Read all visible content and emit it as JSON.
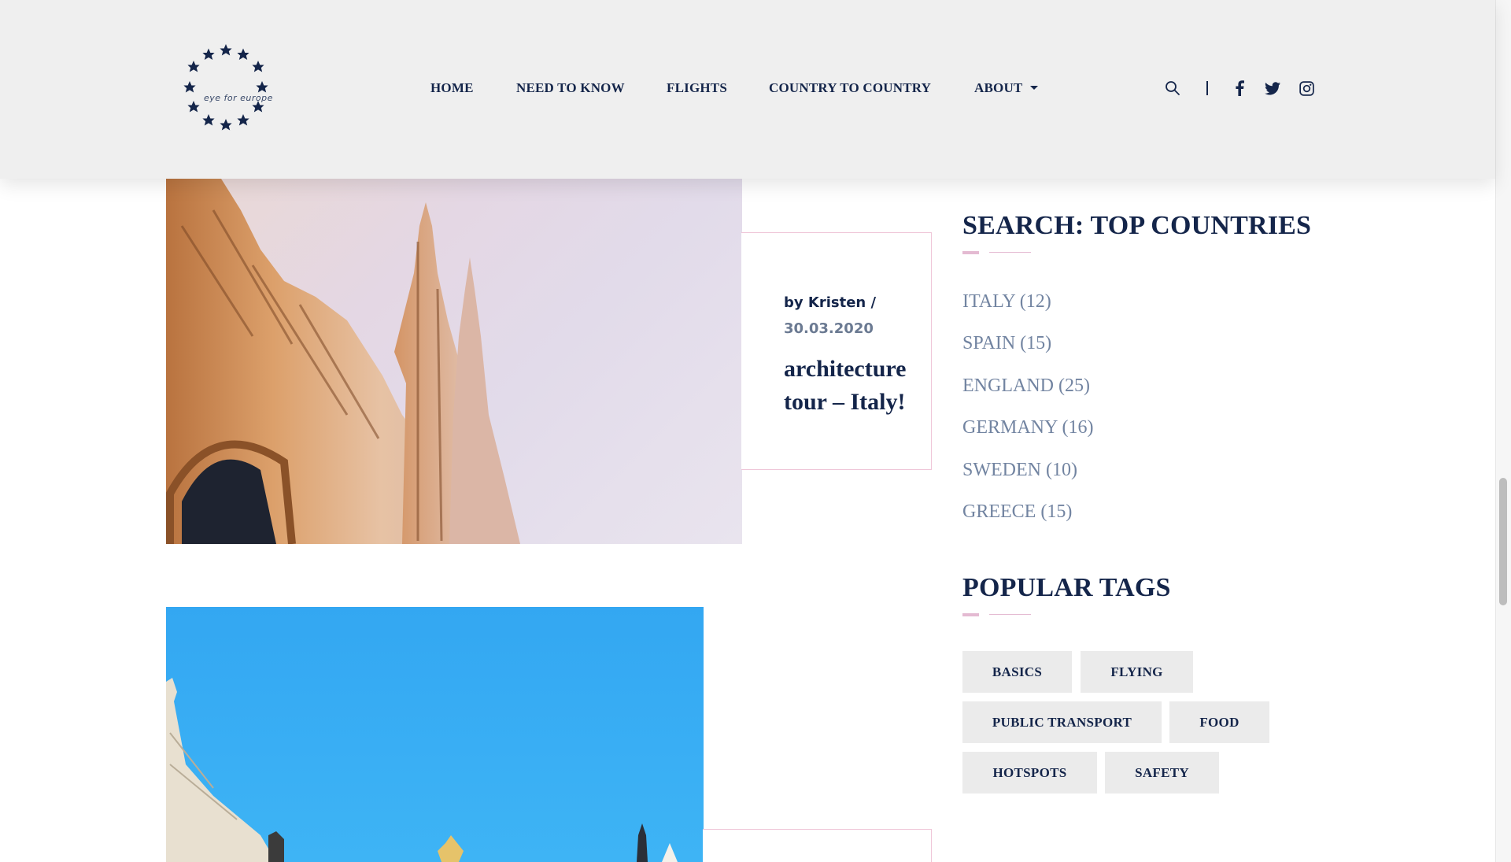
{
  "brand": {
    "logo_text": "eye for europe"
  },
  "nav": {
    "items": [
      {
        "label": "HOME"
      },
      {
        "label": "NEED TO KNOW"
      },
      {
        "label": "FLIGHTS"
      },
      {
        "label": "COUNTRY TO COUNTRY"
      },
      {
        "label": "ABOUT"
      }
    ]
  },
  "header_icons": [
    "search-icon",
    "facebook-icon",
    "twitter-icon",
    "instagram-icon"
  ],
  "posts": [
    {
      "author": "by Kristen /",
      "date": "30.03.2020",
      "title": "architecture tour – Italy!"
    }
  ],
  "sidebar": {
    "countries_heading": "SEARCH: TOP COUNTRIES",
    "countries": [
      {
        "label": "ITALY (12)"
      },
      {
        "label": "SPAIN (15)"
      },
      {
        "label": "ENGLAND (25)"
      },
      {
        "label": "GERMANY (16)"
      },
      {
        "label": "SWEDEN (10)"
      },
      {
        "label": "GREECE (15)"
      }
    ],
    "tags_heading": "POPULAR TAGS",
    "tags": [
      {
        "label": "BASICS"
      },
      {
        "label": "FLYING"
      },
      {
        "label": "PUBLIC TRANSPORT"
      },
      {
        "label": "FOOD"
      },
      {
        "label": "HOTSPOTS"
      },
      {
        "label": "SAFETY"
      }
    ]
  },
  "colors": {
    "navy": "#14254a",
    "muted": "#7284a1",
    "accent_pink": "#e4bad2",
    "header_bg": "#efefef",
    "tag_bg": "#ebebeb"
  }
}
